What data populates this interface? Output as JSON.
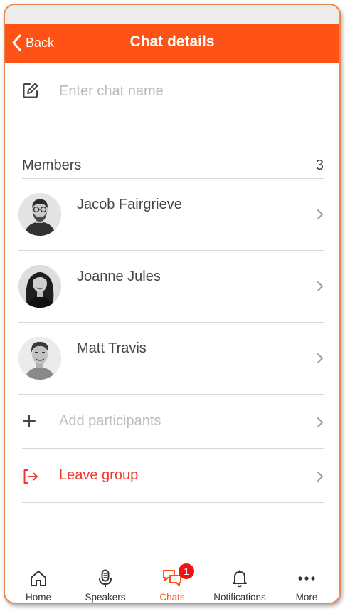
{
  "header": {
    "back_label": "Back",
    "title": "Chat details"
  },
  "chat_name": {
    "placeholder": "Enter chat name",
    "value": ""
  },
  "members": {
    "label": "Members",
    "count": "3",
    "items": [
      {
        "name": "Jacob Fairgrieve"
      },
      {
        "name": "Joanne Jules"
      },
      {
        "name": "Matt Travis"
      }
    ]
  },
  "actions": {
    "add_participants": "Add participants",
    "leave_group": "Leave group"
  },
  "tabs": [
    {
      "label": "Home",
      "icon": "home-icon"
    },
    {
      "label": "Speakers",
      "icon": "microphone-icon"
    },
    {
      "label": "Chats",
      "icon": "chat-bubbles-icon",
      "badge": "1",
      "active": true
    },
    {
      "label": "Notifications",
      "icon": "bell-icon"
    },
    {
      "label": "More",
      "icon": "more-dots-icon"
    }
  ],
  "colors": {
    "brand": "#ff5216",
    "danger": "#f0392b",
    "badge": "#f21010",
    "frame": "#e8884a"
  }
}
